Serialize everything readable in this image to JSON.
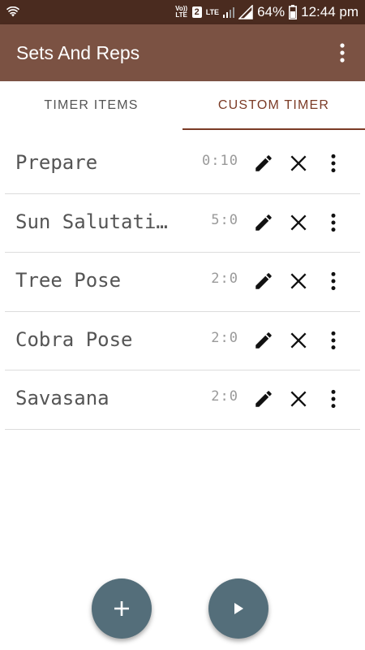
{
  "status_bar": {
    "volte": "Vo)) LTE",
    "sim": "2",
    "network": "LTE",
    "battery": "64%",
    "time": "12:44 pm"
  },
  "app_bar": {
    "title": "Sets And Reps",
    "overflow_icon": "more-vert-icon"
  },
  "tabs": [
    {
      "label": "TIMER ITEMS",
      "active": false
    },
    {
      "label": "CUSTOM TIMER",
      "active": true
    }
  ],
  "items": [
    {
      "name": "Prepare",
      "time": "0:10"
    },
    {
      "name": "Sun Salutations",
      "time": "5:0"
    },
    {
      "name": "Tree Pose",
      "time": "2:0"
    },
    {
      "name": "Cobra Pose",
      "time": "2:0"
    },
    {
      "name": "Savasana",
      "time": "2:0"
    }
  ],
  "item_icons": {
    "edit": "pencil-icon",
    "delete": "close-icon",
    "more": "more-vert-icon"
  },
  "fabs": {
    "add": "plus-icon",
    "play": "play-icon"
  },
  "colors": {
    "status_bar": "#4a2b1f",
    "app_bar": "#7b5243",
    "tab_active": "#7b3b26",
    "fab": "#546e7a"
  }
}
